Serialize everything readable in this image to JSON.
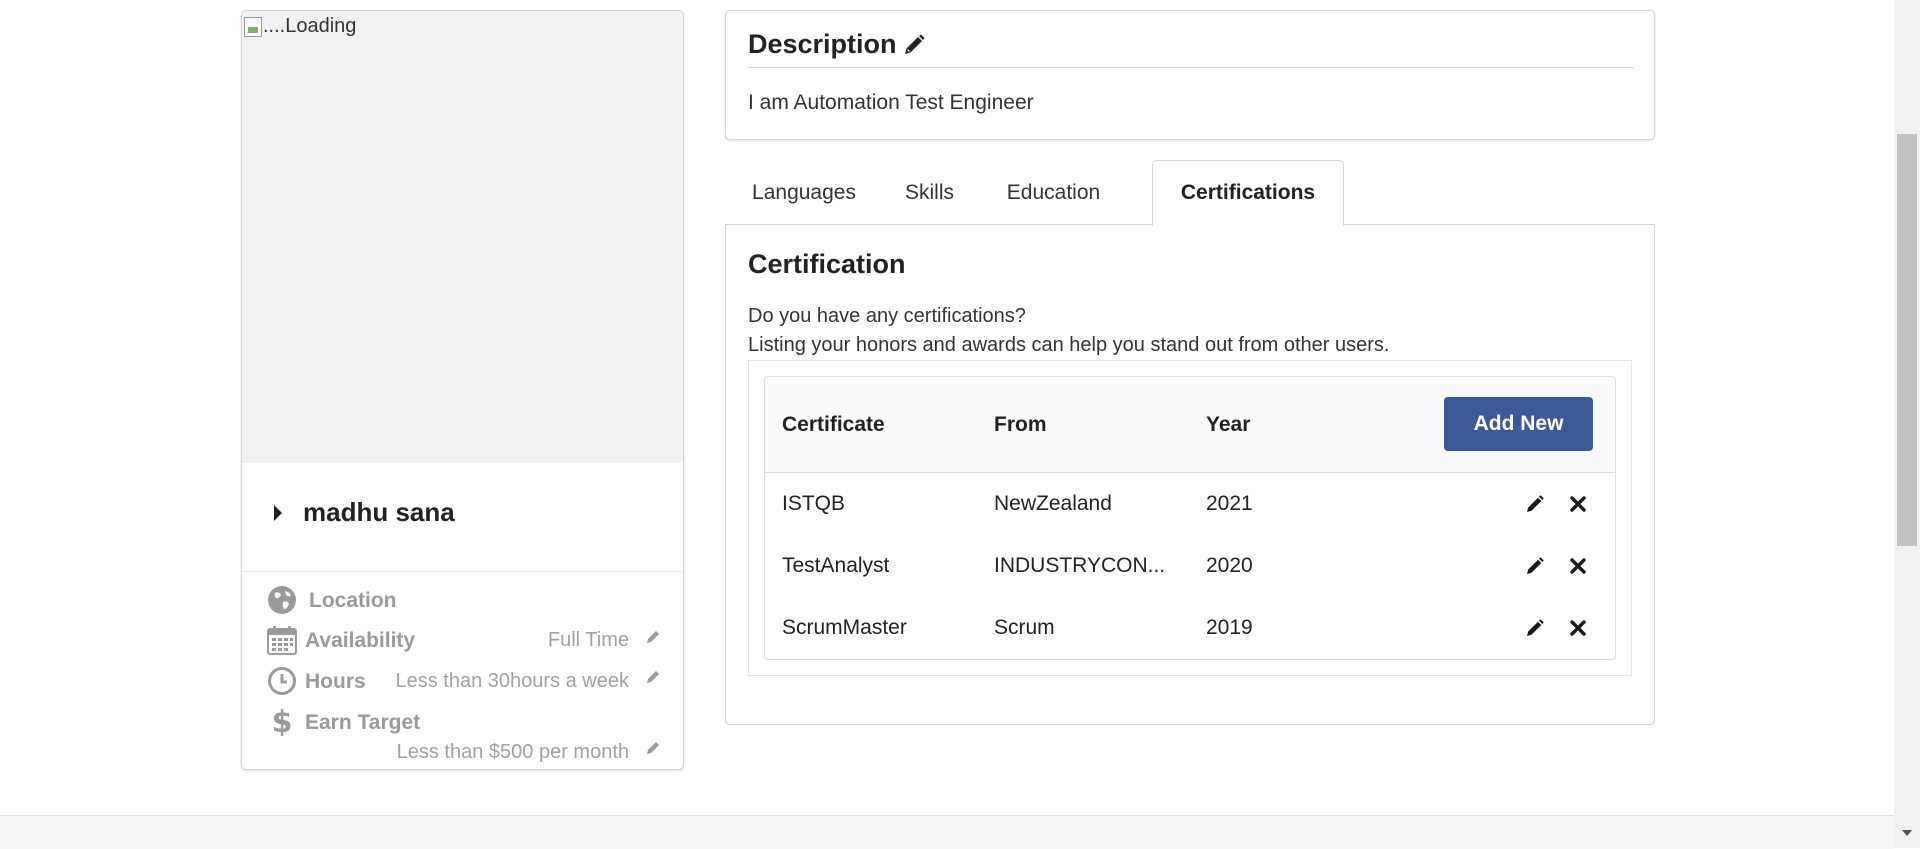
{
  "profile": {
    "photo_alt": "....Loading",
    "name": "madhu sana",
    "details": {
      "location_label": "Location",
      "availability_label": "Availability",
      "availability_value": "Full Time",
      "hours_label": "Hours",
      "hours_value": "Less than 30hours a week",
      "earn_label": "Earn Target",
      "earn_value": "Less than $500 per month"
    }
  },
  "description": {
    "title": "Description",
    "text": "I am Automation Test Engineer"
  },
  "tabs": [
    {
      "label": "Languages"
    },
    {
      "label": "Skills"
    },
    {
      "label": "Education"
    },
    {
      "label": "Certifications"
    }
  ],
  "certification": {
    "title": "Certification",
    "question": "Do you have any certifications?",
    "subtitle": "Listing your honors and awards can help you stand out from other users.",
    "columns": [
      "Certificate",
      "From",
      "Year"
    ],
    "add_button": "Add New",
    "rows": [
      {
        "certificate": "ISTQB",
        "from": "NewZealand",
        "year": "2021"
      },
      {
        "certificate": "TestAnalyst",
        "from": "INDUSTRYCON...",
        "year": "2020"
      },
      {
        "certificate": "ScrumMaster",
        "from": "Scrum",
        "year": "2019"
      }
    ]
  },
  "colors": {
    "primary_button": "#3b5998",
    "muted_text": "#9a9a9a"
  }
}
